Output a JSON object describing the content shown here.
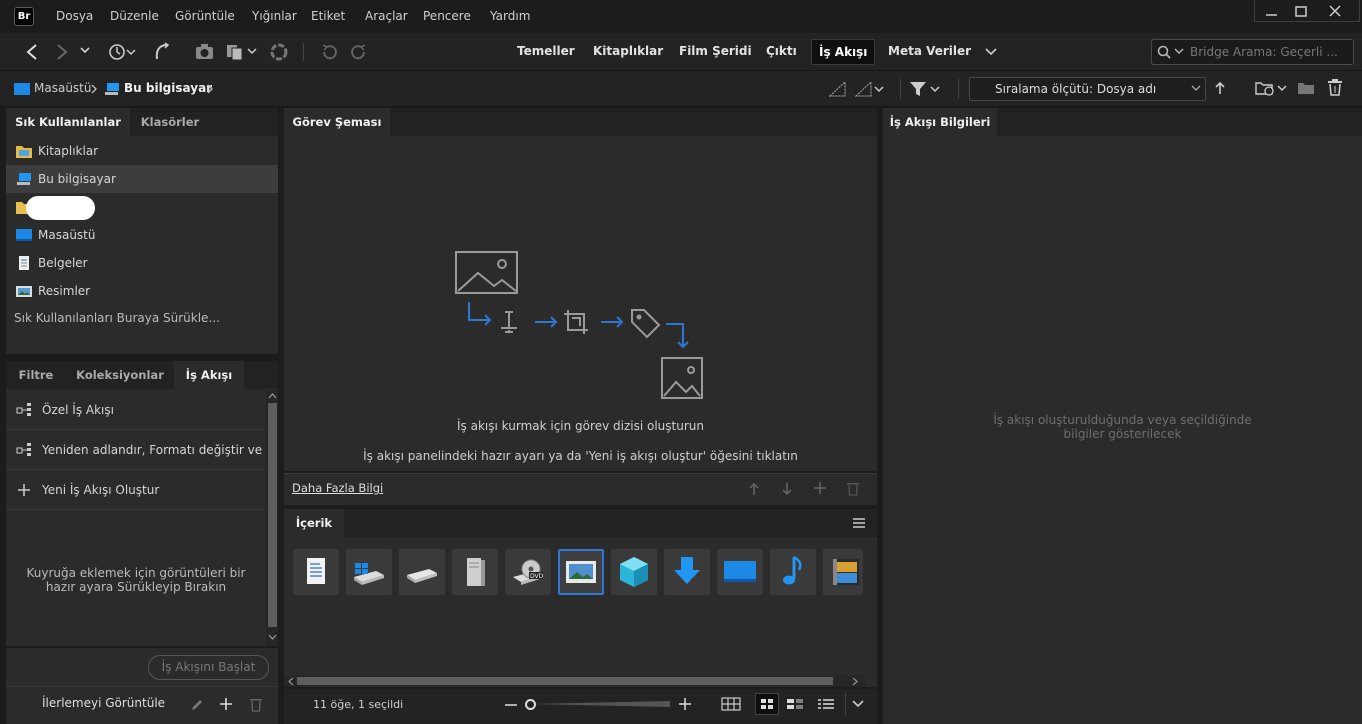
{
  "app": {
    "logo": "Br"
  },
  "menu": [
    "Dosya",
    "Düzenle",
    "Görüntüle",
    "Yığınlar",
    "Etiket",
    "Araçlar",
    "Pencere",
    "Yardım"
  ],
  "workspaces": {
    "items": [
      "Temeller",
      "Kitaplıklar",
      "Film Şeridi",
      "Çıktı"
    ],
    "active": "İş Akışı",
    "after": [
      "Meta Veriler"
    ]
  },
  "search": {
    "placeholder": "Bridge Arama: Geçerli ..."
  },
  "breadcrumb": {
    "items": [
      "Masaüstü",
      "Bu bilgisayar"
    ]
  },
  "sort": {
    "label": "Sıralama ölçütü: Dosya adı"
  },
  "left_tabs": [
    "Sık Kullanılanlar",
    "Klasörler"
  ],
  "favorites": {
    "items": [
      {
        "label": "Kitaplıklar",
        "icon": "libraries-icon"
      },
      {
        "label": "Bu bilgisayar",
        "icon": "this-pc-icon"
      },
      {
        "label": "",
        "icon": "user-folder-icon"
      },
      {
        "label": "Masaüstü",
        "icon": "desktop-icon"
      },
      {
        "label": "Belgeler",
        "icon": "documents-icon"
      },
      {
        "label": "Resimler",
        "icon": "pictures-icon"
      }
    ],
    "drop_hint": "Sık Kullanılanları Buraya Sürükle..."
  },
  "bottom_tabs": [
    "Filtre",
    "Koleksiyonlar",
    "İş Akışı"
  ],
  "workflow": {
    "items": [
      "Özel İş Akışı",
      "Yeniden adlandır, Formatı değiştir ve Y...",
      "Yeni İş Akışı Oluştur"
    ],
    "queue_hint_1": "Kuyruğa eklemek için görüntüleri bir",
    "queue_hint_2": "hazır ayara Sürükleyip Bırakın",
    "start_button": "İş Akışını Başlat",
    "progress_label": "İlerlemeyi Görüntüle"
  },
  "task_schema": {
    "tab": "Görev Şeması",
    "line1": "İş akışı kurmak için görev dizisi oluşturun",
    "line2": "İş akışı panelindeki hazır ayarı ya da 'Yeni iş akışı oluştur' öğesini tıklatın",
    "more_link": "Daha Fazla Bilgi"
  },
  "content": {
    "tab": "İçerik",
    "thumbnails": [
      "document-icon",
      "drive-windows-icon",
      "drive-icon",
      "tower-drive-icon",
      "dvd-drive-icon",
      "pictures-folder-icon",
      "3d-objects-icon",
      "downloads-icon",
      "desktop-folder-icon",
      "music-icon",
      "videos-icon"
    ],
    "status": "11 öğe, 1 seçildi"
  },
  "info": {
    "tab": "İş Akışı Bilgileri",
    "empty_1": "İş akışı oluşturulduğunda veya seçildiğinde",
    "empty_2": "bilgiler gösterilecek"
  },
  "colors": {
    "accent": "#2f76d3",
    "bg": "#2b2b2b"
  }
}
